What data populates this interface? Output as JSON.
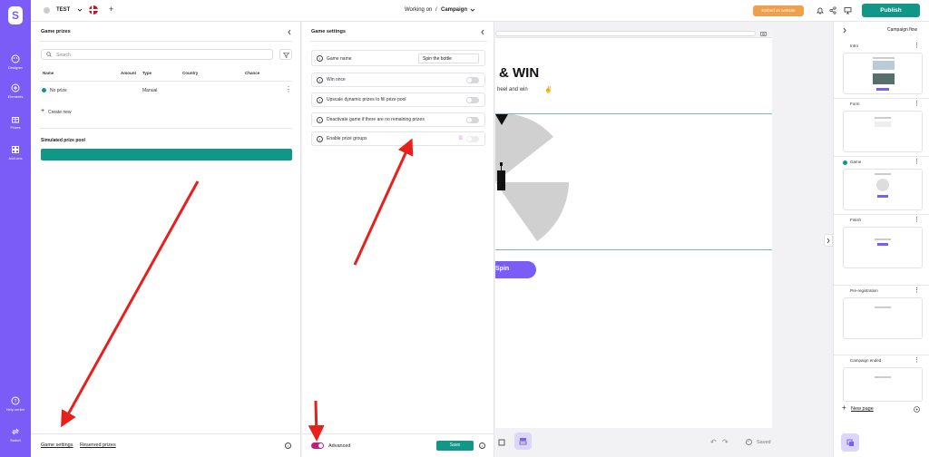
{
  "rail": {
    "logo": "S",
    "items": [
      {
        "label": "Designer"
      },
      {
        "label": "Elements"
      },
      {
        "label": "Prizes"
      },
      {
        "label": "Add-ons"
      }
    ],
    "bottom": [
      {
        "label": "Help center"
      },
      {
        "label": "Switch"
      }
    ]
  },
  "topbar": {
    "project": "TEST",
    "working_on": "Working on",
    "separator": "/",
    "campaign": "Campaign",
    "embed": "Embed on website",
    "publish": "Publish"
  },
  "prizes_panel": {
    "title": "Game prizes",
    "search_placeholder": "Search",
    "columns": [
      "Name",
      "Amount",
      "Type",
      "Country",
      "Chance"
    ],
    "rows": [
      {
        "name": "No prize",
        "type": "Manual"
      }
    ],
    "create_new": "Create new",
    "pool_title": "Simulated prize pool",
    "footer_settings": "Game settings",
    "footer_reserved": "Reserved prizes"
  },
  "settings_panel": {
    "title": "Game settings",
    "game_name_label": "Game name",
    "game_name_value": "Spin the bottle",
    "rows": [
      {
        "label": "Win once"
      },
      {
        "label": "Upscale dynamic prizes to fill prize pool"
      },
      {
        "label": "Deactivate game if there are no remaining prizes"
      },
      {
        "label": "Enable prize groups"
      }
    ],
    "advanced": "Advanced",
    "save": "Save"
  },
  "canvas": {
    "headline": "& WIN",
    "subline": "heel and win",
    "spin": "Spin",
    "saved": "Saved"
  },
  "flow": {
    "title": "Campaign flow",
    "pages": [
      {
        "label": "Intro"
      },
      {
        "label": "Form"
      },
      {
        "label": "Game"
      },
      {
        "label": "Finish"
      },
      {
        "label": "Pre-registration"
      },
      {
        "label": "Campaign ended"
      }
    ],
    "new_page": "New page"
  },
  "colors": {
    "brand": "#7b5cf6",
    "teal": "#129688",
    "orange": "#f0a04b",
    "arrow": "#e8201c"
  }
}
